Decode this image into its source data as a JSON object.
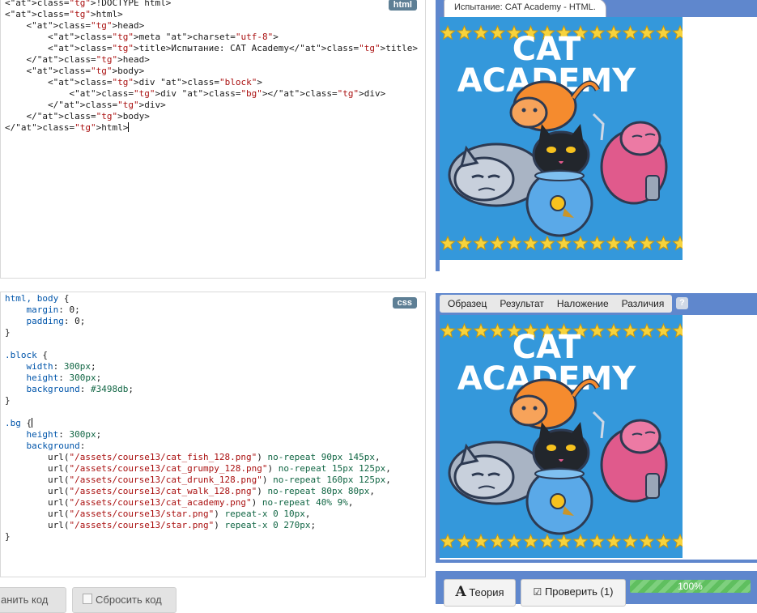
{
  "html_editor": {
    "badge": "html",
    "lines": [
      "<!DOCTYPE html>",
      "<html>",
      "    <head>",
      "        <meta charset=\"utf-8\">",
      "        <title>Испытание: CAT Academy</title>",
      "    </head>",
      "    <body>",
      "        <div class=\"block\">",
      "            <div class=\"bg\"></div>",
      "        </div>",
      "    </body>",
      "</html>"
    ]
  },
  "css_editor": {
    "badge": "css",
    "lines": [
      "html, body {",
      "    margin: 0;",
      "    padding: 0;",
      "}",
      "",
      ".block {",
      "    width: 300px;",
      "    height: 300px;",
      "    background: #3498db;",
      "}",
      "",
      ".bg {",
      "    height: 300px;",
      "    background:",
      "        url(\"/assets/course13/cat_fish_128.png\") no-repeat 90px 145px,",
      "        url(\"/assets/course13/cat_grumpy_128.png\") no-repeat 15px 125px,",
      "        url(\"/assets/course13/cat_drunk_128.png\") no-repeat 160px 125px,",
      "        url(\"/assets/course13/cat_walk_128.png\") no-repeat 80px 80px,",
      "        url(\"/assets/course13/cat_academy.png\") no-repeat 40% 9%,",
      "        url(\"/assets/course13/star.png\") repeat-x 0 10px,",
      "        url(\"/assets/course13/star.png\") repeat-x 0 270px;",
      "}"
    ]
  },
  "preview": {
    "tab_title": "Испытание: CAT Academy - HTML.",
    "scene_title_line1": "CAT",
    "scene_title_line2": "ACADEMY",
    "background_color": "#3498db"
  },
  "compare": {
    "modes": [
      "Образец",
      "Результат",
      "Наложение",
      "Различия"
    ],
    "help": "?"
  },
  "buttons": {
    "save": "анить код",
    "reset": "Сбросить код",
    "theory": "Теория",
    "check": "Проверить (1)",
    "progress": "100%"
  },
  "colors": {
    "panel_blue": "#5f87cd",
    "progress_green": "#6cc86c",
    "star_yellow": "#f7d33c"
  }
}
